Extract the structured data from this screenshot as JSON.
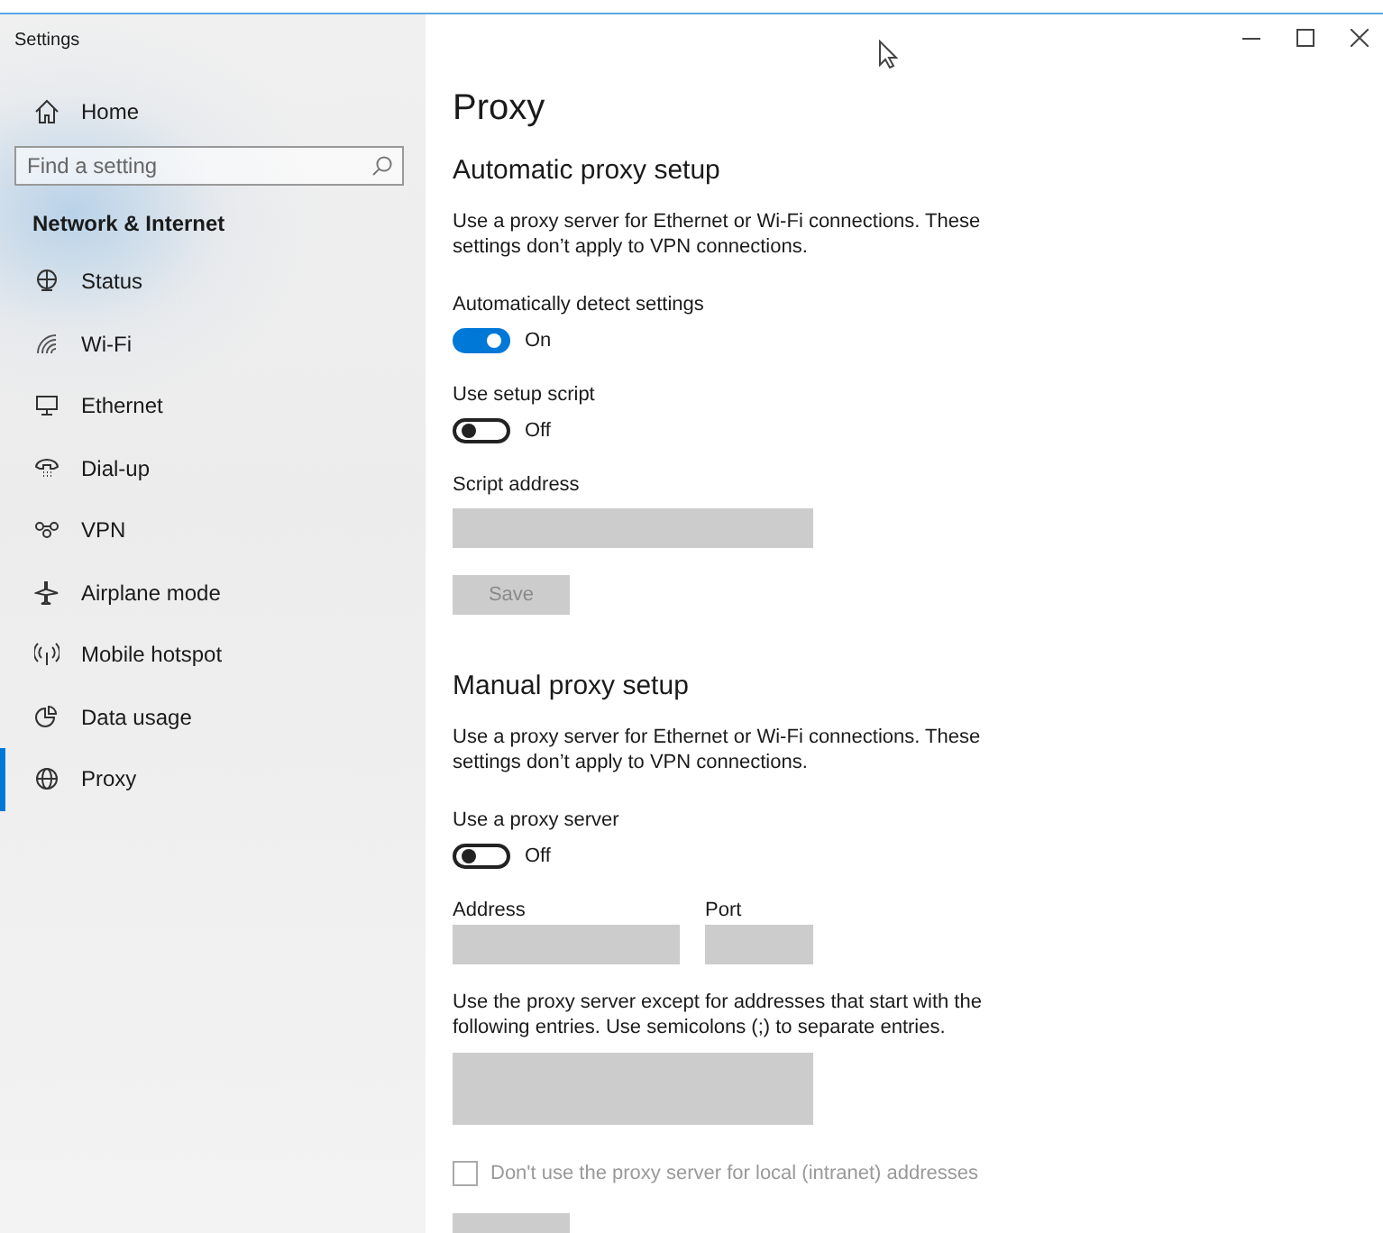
{
  "window": {
    "title": "Settings"
  },
  "sidebar": {
    "home": {
      "label": "Home"
    },
    "search": {
      "placeholder": "Find a setting"
    },
    "section": "Network & Internet",
    "items": [
      {
        "label": "Status",
        "selected": false
      },
      {
        "label": "Wi-Fi",
        "selected": false
      },
      {
        "label": "Ethernet",
        "selected": false
      },
      {
        "label": "Dial-up",
        "selected": false
      },
      {
        "label": "VPN",
        "selected": false
      },
      {
        "label": "Airplane mode",
        "selected": false
      },
      {
        "label": "Mobile hotspot",
        "selected": false
      },
      {
        "label": "Data usage",
        "selected": false
      },
      {
        "label": "Proxy",
        "selected": true
      }
    ]
  },
  "page_title": "Proxy",
  "sections": [
    {
      "heading": "Automatic proxy setup",
      "description": "Use a proxy server for Ethernet or Wi-Fi connections. These settings don’t apply to VPN connections.",
      "controls": [
        {
          "kind": "toggle",
          "label": "Automatically detect settings",
          "on": true,
          "state_text": "On"
        },
        {
          "kind": "toggle",
          "label": "Use setup script",
          "on": false,
          "state_text": "Off"
        },
        {
          "kind": "field",
          "label": "Script address",
          "disabled": true
        },
        {
          "kind": "button",
          "label": "Save",
          "disabled": true
        }
      ]
    },
    {
      "heading": "Manual proxy setup",
      "description": "Use a proxy server for Ethernet or Wi-Fi connections. These settings don’t apply to VPN connections.",
      "controls": [
        {
          "kind": "toggle",
          "label": "Use a proxy server",
          "on": false,
          "state_text": "Off"
        },
        {
          "kind": "address_port",
          "address_label": "Address",
          "port_label": "Port",
          "disabled": true
        },
        {
          "kind": "textarea",
          "label": "Use the proxy server except for addresses that start with the following entries. Use semicolons (;) to separate entries.",
          "disabled": true
        },
        {
          "kind": "checkbox",
          "label": "Don't use the proxy server for local (intranet) addresses",
          "checked": false,
          "disabled": true
        },
        {
          "kind": "cut_button",
          "disabled": true
        }
      ]
    }
  ]
}
